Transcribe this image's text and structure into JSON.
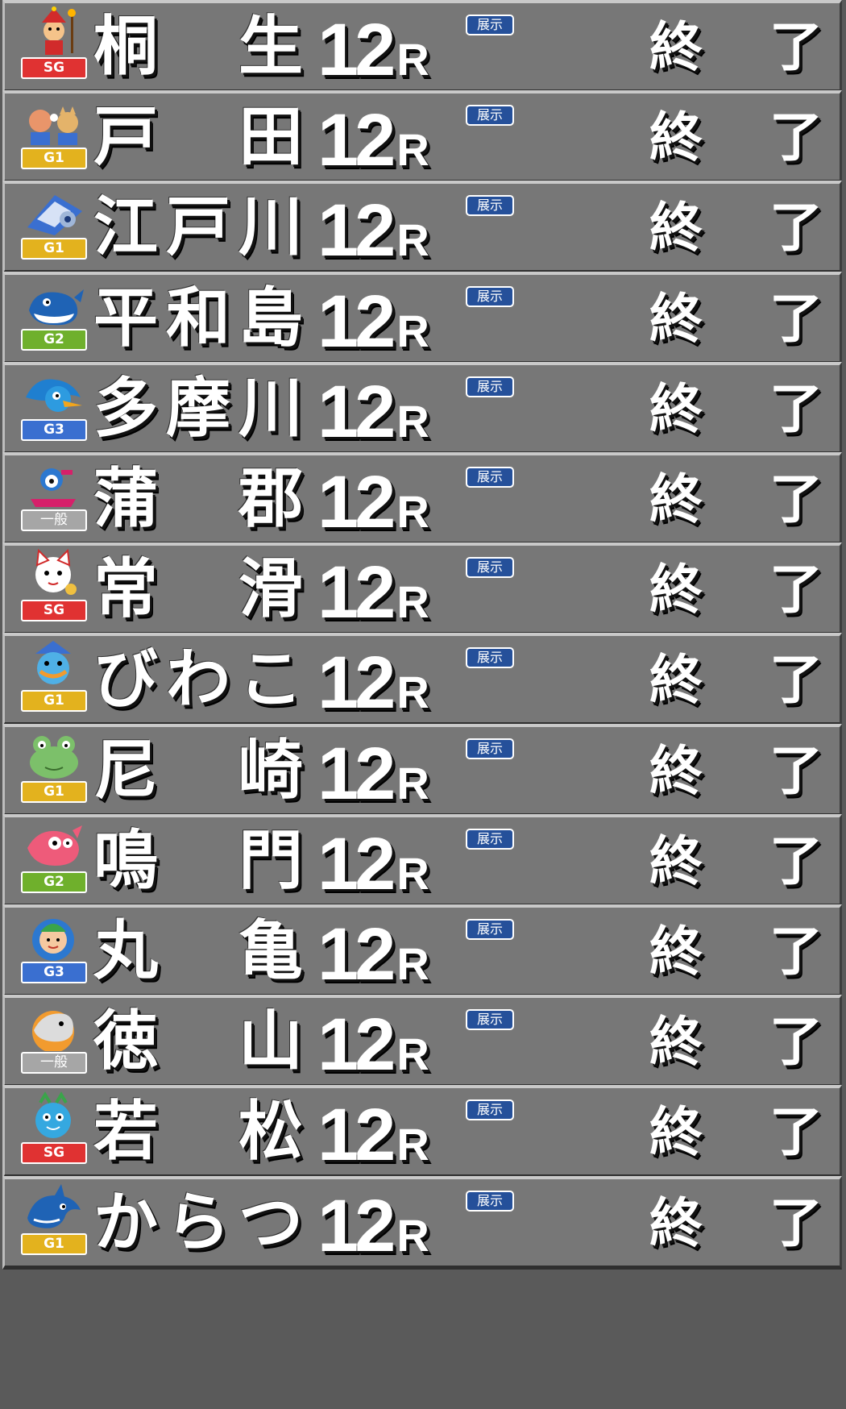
{
  "tenji_label": "展示",
  "status_chars": [
    "終",
    "了"
  ],
  "race_r": "R",
  "colors": {
    "SG": "#e03232",
    "G1": "#e3b21e",
    "G2": "#6fb02c",
    "G3": "#3a6fd0",
    "一般": "#a6a6a6"
  },
  "venues": [
    {
      "name": [
        "桐",
        "生"
      ],
      "race": "12",
      "grade": "SG",
      "mascot": "jester-mascot-icon"
    },
    {
      "name": [
        "戸",
        "田"
      ],
      "race": "12",
      "grade": "G1",
      "mascot": "two-cats-mascot-icon"
    },
    {
      "name": [
        "江",
        "戸",
        "川"
      ],
      "race": "12",
      "grade": "G1",
      "mascot": "checkered-flag-mascot-icon"
    },
    {
      "name": [
        "平",
        "和",
        "島"
      ],
      "race": "12",
      "grade": "G2",
      "mascot": "whale-mascot-icon"
    },
    {
      "name": [
        "多",
        "摩",
        "川"
      ],
      "race": "12",
      "grade": "G3",
      "mascot": "bird-mascot-icon"
    },
    {
      "name": [
        "蒲",
        "郡"
      ],
      "race": "12",
      "grade": "一般",
      "mascot": "boat-racer-mascot-icon"
    },
    {
      "name": [
        "常",
        "滑"
      ],
      "race": "12",
      "grade": "SG",
      "mascot": "lucky-cat-mascot-icon"
    },
    {
      "name": [
        "び",
        "わ",
        "こ"
      ],
      "race": "12",
      "grade": "G1",
      "mascot": "kappa-mascot-icon"
    },
    {
      "name": [
        "尼",
        "崎"
      ],
      "race": "12",
      "grade": "G1",
      "mascot": "frog-mascot-icon"
    },
    {
      "name": [
        "鳴",
        "門"
      ],
      "race": "12",
      "grade": "G2",
      "mascot": "sea-bream-mascot-icon"
    },
    {
      "name": [
        "丸",
        "亀"
      ],
      "race": "12",
      "grade": "G3",
      "mascot": "boy-mascot-icon"
    },
    {
      "name": [
        "徳",
        "山"
      ],
      "race": "12",
      "grade": "一般",
      "mascot": "dolphin-mascot-icon"
    },
    {
      "name": [
        "若",
        "松"
      ],
      "race": "12",
      "grade": "SG",
      "mascot": "sea-creature-mascot-icon"
    },
    {
      "name": [
        "か",
        "ら",
        "つ"
      ],
      "race": "12",
      "grade": "G1",
      "mascot": "dragon-mascot-icon"
    }
  ]
}
